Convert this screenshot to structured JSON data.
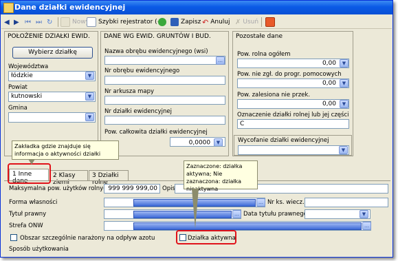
{
  "window": {
    "title": "Dane działki ewidencyjnej"
  },
  "toolbar": {
    "nowy_label": "Nowy",
    "szybki_label": "Szybki rejestrator (+)",
    "zapisz_label": "Zapisz",
    "anuluj_label": "Anuluj",
    "usun_label": "Usuń"
  },
  "left_panel": {
    "header": "POŁOŻENIE DZIAŁKI EWID.",
    "select_button": "Wybierz działkę",
    "wojewodztwo_label": "Województwa",
    "wojewodztwo_value": "łódzkie",
    "powiat_label": "Powiat",
    "powiat_value": "kutnowski",
    "gmina_label": "Gmina",
    "gmina_value": ""
  },
  "middle_panel": {
    "header": "DANE WG EWID. GRUNTÓW I BUD.",
    "nazwa_obrebu_label": "Nazwa obrębu ewidencyjnego (wsi)",
    "nr_obrebu_label": "Nr obrębu ewidencyjnego",
    "nr_arkusza_label": "Nr arkusza mapy",
    "nr_dzialki_label": "Nr działki ewidencyjnej",
    "pow_calkowita_label": "Pow. całkowita działki ewidencyjnej",
    "pow_calkowita_value": "0,0000"
  },
  "right_panel": {
    "header": "Pozostałe dane",
    "pow_rolna_label": "Pow. rolna ogółem",
    "pow_rolna_value": "0,00",
    "pow_niezgl_label": "Pow. nie zgł. do progr. pomocowych",
    "pow_niezgl_value": "0,00",
    "pow_zalesiona_label": "Pow. zalesiona nie przek.",
    "pow_zalesiona_value": "0,00",
    "oznaczenie_label": "Oznaczenie działki rolnej lub jej części",
    "oznaczenie_value": "C",
    "wycofanie_label": "Wycofanie działki ewidencyjnej",
    "wycofanie_value": ""
  },
  "tooltips": {
    "tab_tip": "Zakładka gdzie znajduje się informacja o aktywności działki",
    "active_tip": "Zaznaczone: działka aktywna; Nie zaznaczona: działka nieaktywna"
  },
  "tabs": [
    {
      "label": "1 Inne dane"
    },
    {
      "label": "2 Klasy ziemi"
    },
    {
      "label": "3 Działki rolne"
    }
  ],
  "bottom": {
    "max_pow_label": "Maksymalna pow. użytków rolnych",
    "max_pow_value": "999 999 999,00",
    "opis_label": "Opis",
    "forma_label": "Forma własności",
    "nr_ks_label": "Nr ks. wiecz.",
    "tytul_label": "Tytuł prawny",
    "data_tytulu_label": "Data tytułu prawnego",
    "strefa_label": "Strefa ONW",
    "obszar_label": "Obszar szczególnie narażony na odpływ azotu",
    "dzialka_aktywna_label": "Działka aktywna",
    "sposob_label": "Sposób użytkowania"
  },
  "colors": {
    "title_bar": "#0a5ae6",
    "window_bg": "#ece9d8",
    "highlight": "#e0121a",
    "tooltip_bg": "#ffffe1"
  }
}
